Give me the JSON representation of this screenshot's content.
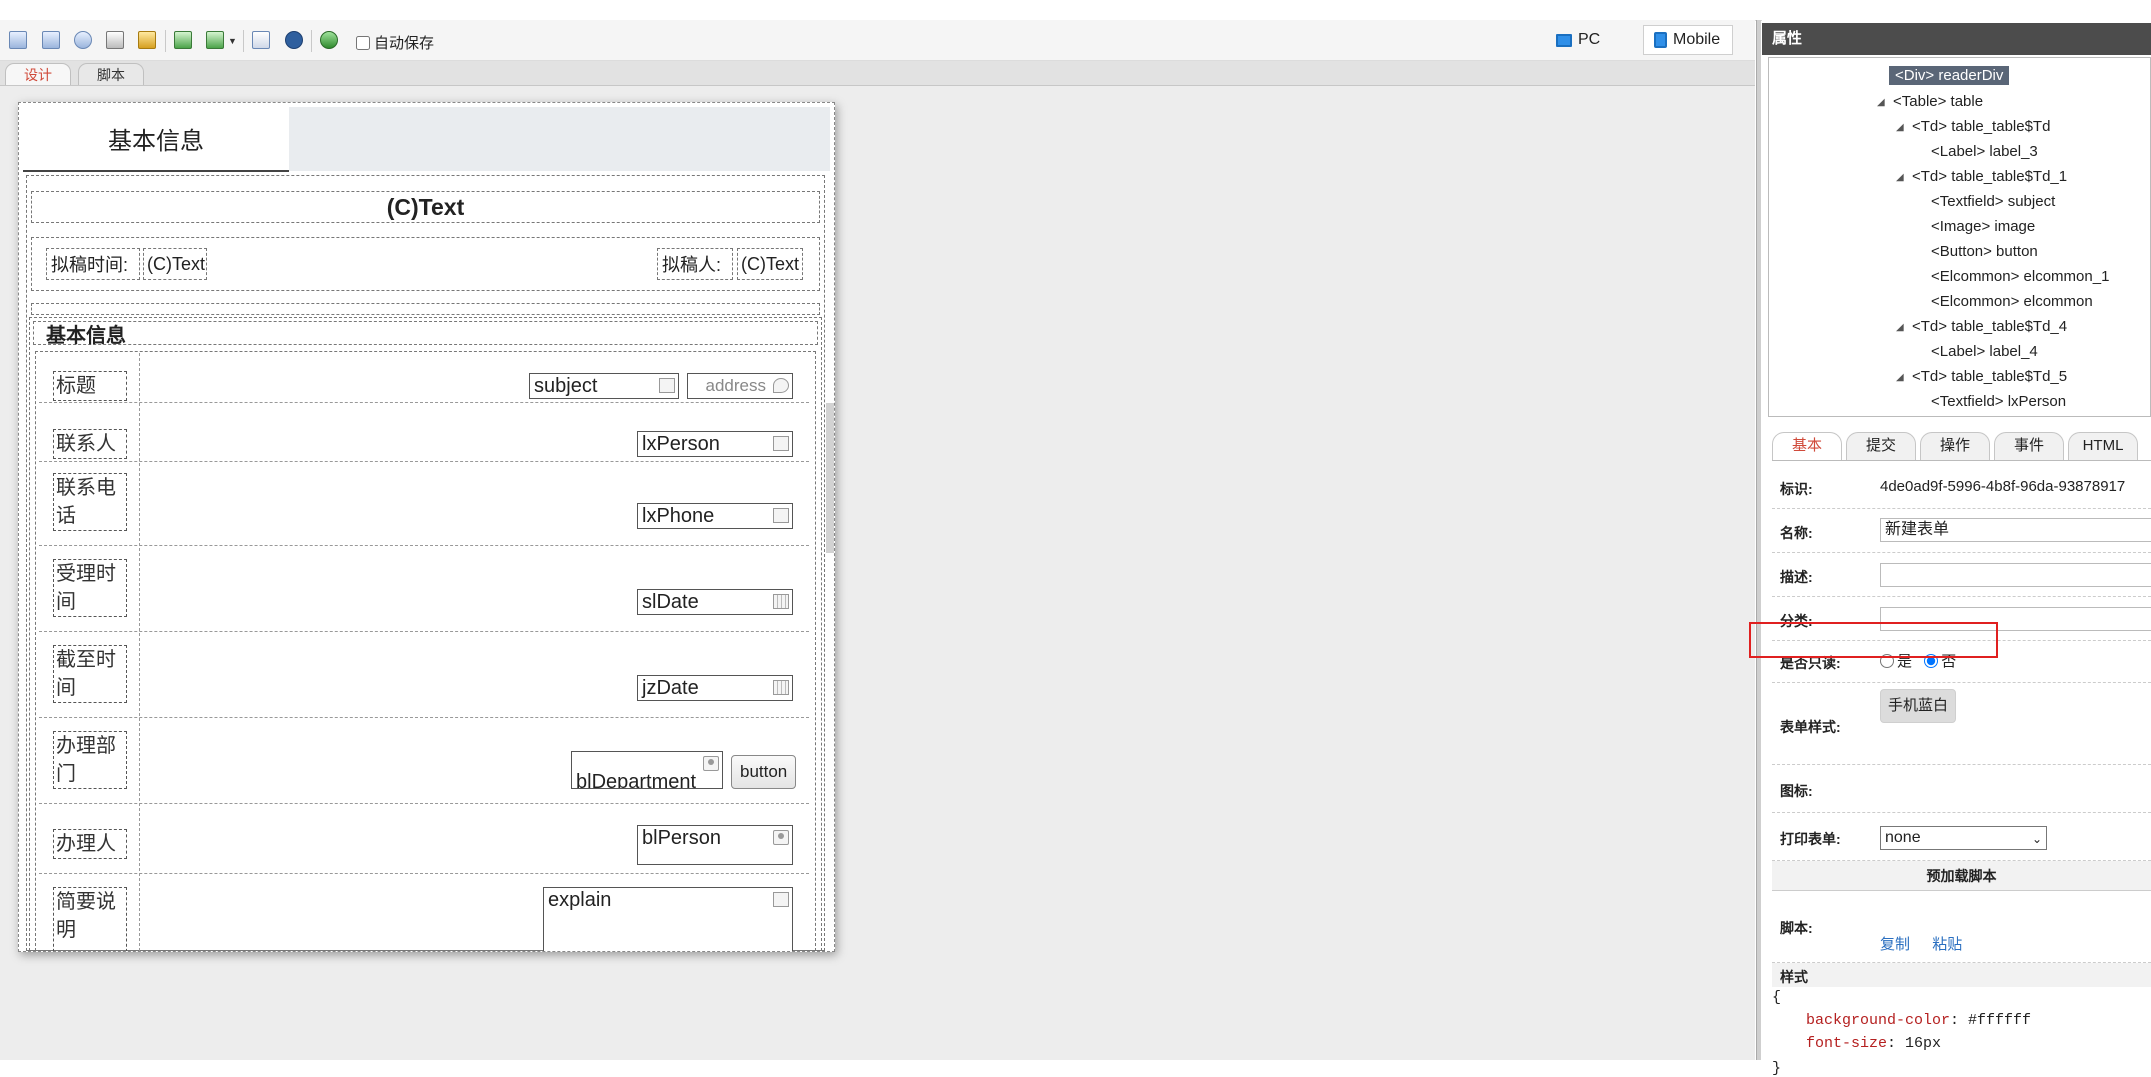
{
  "toolbar": {
    "autosave_label": "自动保存",
    "view_pc": "PC",
    "view_mobile": "Mobile"
  },
  "editor_tabs": {
    "design": "设计",
    "script": "脚本"
  },
  "form": {
    "tab_label": "基本信息",
    "title_text": "(C)Text",
    "draft_time_label": "拟稿时间:",
    "draft_time_value": "(C)Text",
    "drafter_label": "拟稿人:",
    "drafter_value": "(C)Text",
    "section_title": "基本信息",
    "rows": [
      {
        "label": "标题",
        "field": "subject",
        "extra_field": "address"
      },
      {
        "label": "联系人",
        "field": "lxPerson"
      },
      {
        "label": "联系电话",
        "field": "lxPhone"
      },
      {
        "label": "受理时间",
        "field": "slDate"
      },
      {
        "label": "截至时间",
        "field": "jzDate"
      },
      {
        "label": "办理部门",
        "field": "blDepartment",
        "button": "button"
      },
      {
        "label": "办理人",
        "field": "blPerson"
      },
      {
        "label": "简要说明",
        "field": "explain"
      }
    ]
  },
  "panel": {
    "header": "属性",
    "tree": [
      {
        "text": "<Div> readerDiv",
        "selected": true
      },
      {
        "text": "<Table> table"
      },
      {
        "text": "<Td> table_table$Td"
      },
      {
        "text": "<Label> label_3"
      },
      {
        "text": "<Td> table_table$Td_1"
      },
      {
        "text": "<Textfield> subject"
      },
      {
        "text": "<Image> image"
      },
      {
        "text": "<Button> button"
      },
      {
        "text": "<Elcommon> elcommon_1"
      },
      {
        "text": "<Elcommon> elcommon"
      },
      {
        "text": "<Td> table_table$Td_4"
      },
      {
        "text": "<Label> label_4"
      },
      {
        "text": "<Td> table_table$Td_5"
      },
      {
        "text": "<Textfield> lxPerson"
      }
    ],
    "tabs": [
      "基本",
      "提交",
      "操作",
      "事件",
      "HTML"
    ],
    "props": {
      "id_label": "标识:",
      "id_value": "4de0ad9f-5996-4b8f-96da-93878917",
      "name_label": "名称:",
      "name_value": "新建表单",
      "desc_label": "描述:",
      "category_label": "分类:",
      "readonly_label": "是否只读:",
      "readonly_yes": "是",
      "readonly_no": "否",
      "readonly_selected": "否",
      "style_label": "表单样式:",
      "style_button": "手机蓝白",
      "icon_label": "图标:",
      "print_label": "打印表单:",
      "print_value": "none",
      "preload_header": "预加载脚本",
      "script_label": "脚本:",
      "copy_link": "复制",
      "paste_link": "粘贴",
      "css_label": "样式",
      "css_open": "{",
      "css_lines": [
        {
          "prop": "background-color",
          "value": "#ffffff"
        },
        {
          "prop": "font-size",
          "value": "16px"
        }
      ],
      "css_close": "}"
    }
  }
}
